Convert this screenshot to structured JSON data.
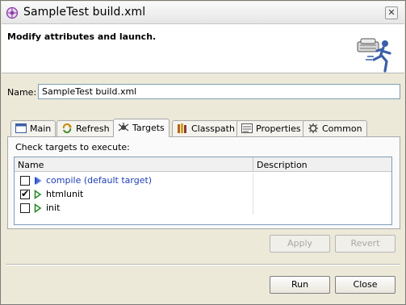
{
  "window": {
    "title": "SampleTest build.xml",
    "close_glyph": "✕"
  },
  "banner": {
    "title": "Modify attributes and launch."
  },
  "name_field": {
    "label": "Name:",
    "value": "SampleTest build.xml"
  },
  "tabs": [
    {
      "label": "Main",
      "icon": "main-tab-icon"
    },
    {
      "label": "Refresh",
      "icon": "refresh-icon"
    },
    {
      "label": "Targets",
      "icon": "targets-icon",
      "active": true
    },
    {
      "label": "Classpath",
      "icon": "classpath-icon"
    },
    {
      "label": "Properties",
      "icon": "properties-icon"
    },
    {
      "label": "Common",
      "icon": "common-icon"
    }
  ],
  "targets_panel": {
    "caption": "Check targets to execute:",
    "columns": [
      "Name",
      "Description"
    ],
    "rows": [
      {
        "name": "compile (default target)",
        "checked": false,
        "default": true
      },
      {
        "name": "htmlunit",
        "checked": true,
        "default": false
      },
      {
        "name": "init",
        "checked": false,
        "default": false
      }
    ]
  },
  "buttons": {
    "apply": "Apply",
    "revert": "Revert",
    "run": "Run",
    "close": "Close"
  },
  "colors": {
    "default_target": "#1f3fb6",
    "target_arrow": "#2e8b2e",
    "default_arrow": "#2a4fc9"
  }
}
